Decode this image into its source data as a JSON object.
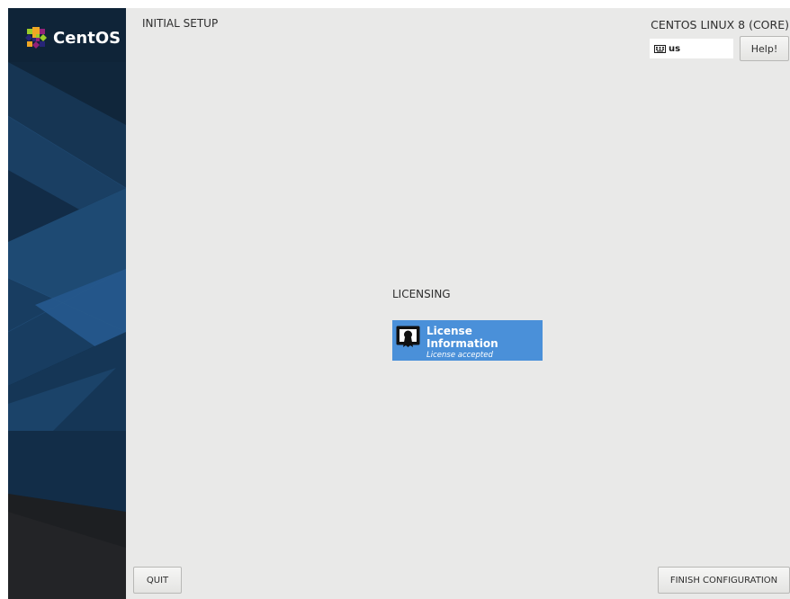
{
  "brand": {
    "name": "CentOS",
    "logo_icon": "centos-logo-icon"
  },
  "header": {
    "page_title": "INITIAL SETUP",
    "product_title": "CENTOS LINUX 8 (CORE)",
    "keyboard_layout": "us",
    "keyboard_icon": "keyboard-icon",
    "help_label": "Help!"
  },
  "hub": {
    "sections": [
      {
        "title": "LICENSING",
        "spokes": [
          {
            "title": "License Information",
            "status": "License accepted",
            "icon": "license-certificate-icon"
          }
        ]
      }
    ]
  },
  "footer": {
    "quit_label": "QUIT",
    "finish_label": "FINISH CONFIGURATION"
  },
  "colors": {
    "accent": "#4a90d9",
    "sidebar": "#0f2438",
    "background": "#e9e9e8"
  }
}
